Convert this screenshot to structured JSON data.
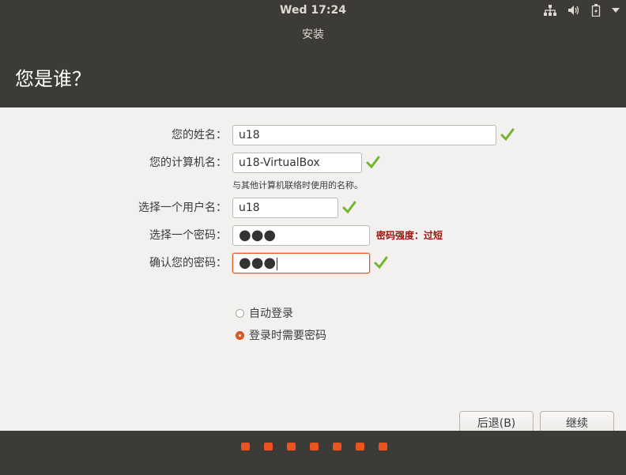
{
  "topbar": {
    "clock": "Wed 17:24",
    "icons": [
      "network-icon",
      "volume-icon",
      "battery-icon",
      "system-menu-arrow-icon"
    ]
  },
  "window": {
    "title": "安装",
    "heading": "您是谁？"
  },
  "form": {
    "name": {
      "label": "您的姓名：",
      "value": "u18"
    },
    "computer": {
      "label": "您的计算机名：",
      "value": "u18-VirtualBox",
      "hint": "与其他计算机联络时使用的名称。"
    },
    "username": {
      "label": "选择一个用户名：",
      "value": "u18"
    },
    "password": {
      "label": "选择一个密码：",
      "value": "●●●",
      "strength": "密码强度：过短"
    },
    "confirm": {
      "label": "确认您的密码：",
      "value": "●●●"
    }
  },
  "login_options": {
    "auto_login": "自动登录",
    "require_password": "登录时需要密码",
    "selected": "require_password"
  },
  "buttons": {
    "back": "后退(B)",
    "continue": "继续"
  },
  "progress": {
    "total_steps": 7,
    "current_step": 7
  },
  "colors": {
    "accent": "#e95420",
    "check": "#73b62c",
    "warning_text": "#a0130b",
    "content_bg": "#f2f1f0",
    "chrome_bg": "#3c3b37"
  }
}
